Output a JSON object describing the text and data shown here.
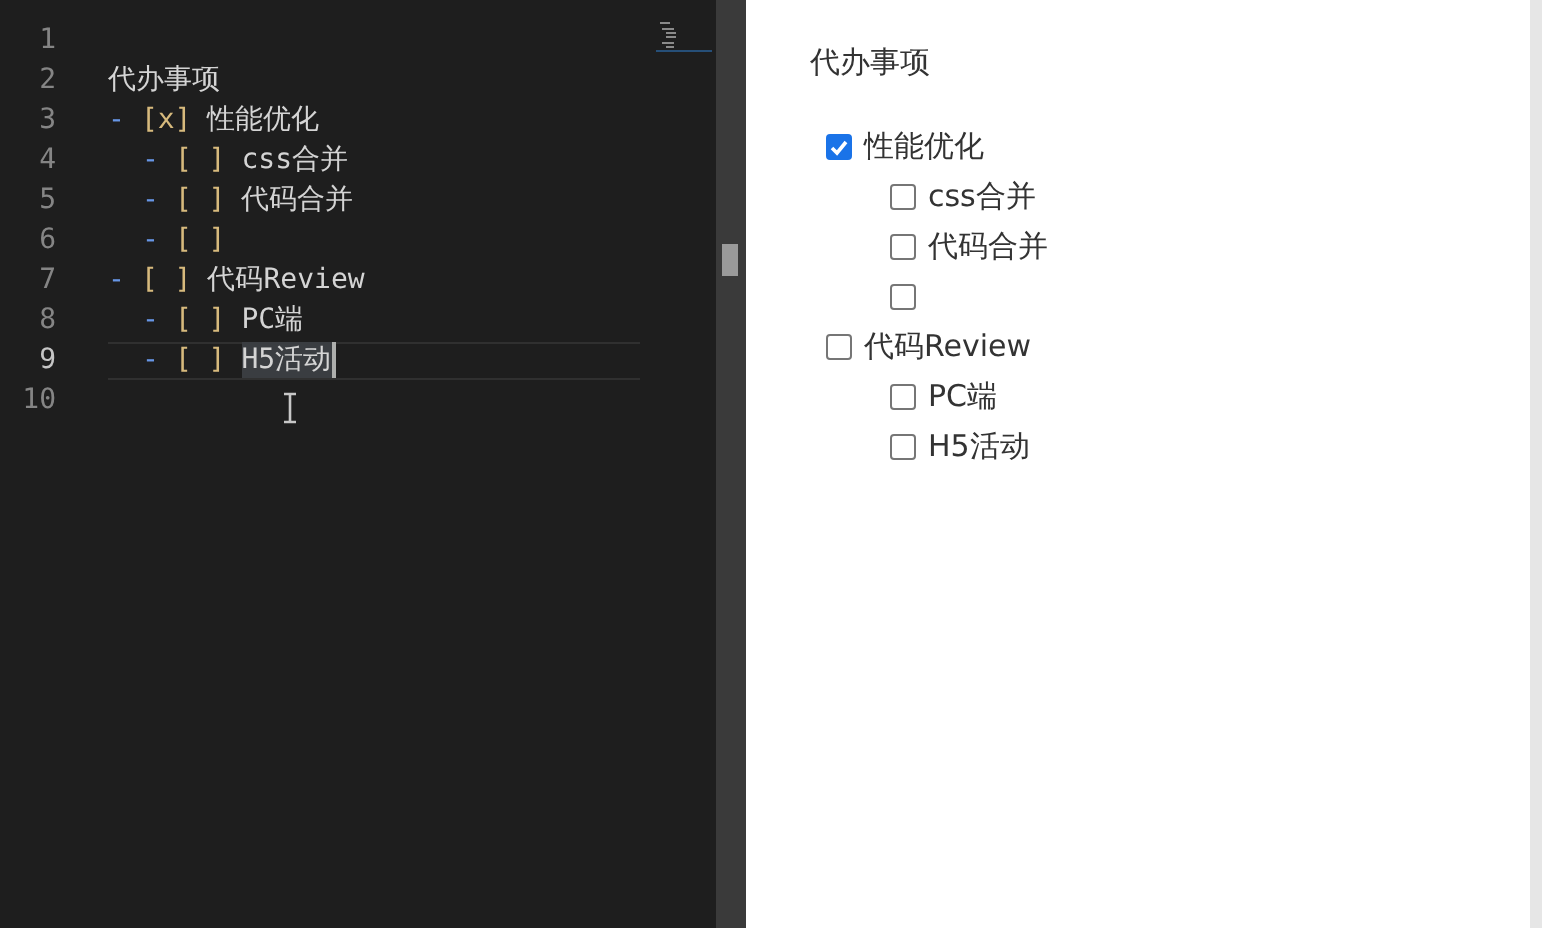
{
  "editor": {
    "lines": [
      {
        "number": "1",
        "current": false
      },
      {
        "number": "2",
        "current": false,
        "segments": [
          {
            "kind": "text",
            "text": "代办事项"
          }
        ]
      },
      {
        "number": "3",
        "current": false,
        "segments": [
          {
            "kind": "marker",
            "text": "-"
          },
          {
            "kind": "box",
            "text": "[x]"
          },
          {
            "kind": "text",
            "text": "性能优化"
          }
        ]
      },
      {
        "number": "4",
        "current": false,
        "segments": [
          {
            "kind": "indent"
          },
          {
            "kind": "marker",
            "text": "-"
          },
          {
            "kind": "box",
            "text": "[ ]"
          },
          {
            "kind": "text",
            "text": "css合并"
          }
        ]
      },
      {
        "number": "5",
        "current": false,
        "segments": [
          {
            "kind": "indent"
          },
          {
            "kind": "marker",
            "text": "-"
          },
          {
            "kind": "box",
            "text": "[ ]"
          },
          {
            "kind": "text",
            "text": "代码合并"
          }
        ]
      },
      {
        "number": "6",
        "current": false,
        "segments": [
          {
            "kind": "indent"
          },
          {
            "kind": "marker",
            "text": "-"
          },
          {
            "kind": "box",
            "text": "[ ]"
          }
        ]
      },
      {
        "number": "7",
        "current": false,
        "segments": [
          {
            "kind": "marker",
            "text": "-"
          },
          {
            "kind": "box",
            "text": "[ ]"
          },
          {
            "kind": "text",
            "text": "代码Review"
          }
        ]
      },
      {
        "number": "8",
        "current": false,
        "segments": [
          {
            "kind": "indent"
          },
          {
            "kind": "marker",
            "text": "-"
          },
          {
            "kind": "box",
            "text": "[ ]"
          },
          {
            "kind": "text",
            "text": "PC端"
          }
        ]
      },
      {
        "number": "9",
        "current": true,
        "segments": [
          {
            "kind": "indent"
          },
          {
            "kind": "marker",
            "text": "-"
          },
          {
            "kind": "box",
            "text": "[ ]"
          },
          {
            "kind": "selected",
            "text": "H5活动"
          }
        ]
      },
      {
        "number": "10",
        "current": false
      }
    ]
  },
  "preview": {
    "title": "代办事项",
    "items": [
      {
        "label": "性能优化",
        "checked": true,
        "children": [
          {
            "label": "css合并",
            "checked": false
          },
          {
            "label": "代码合并",
            "checked": false
          },
          {
            "checked": false
          }
        ]
      },
      {
        "label": "代码Review",
        "checked": false,
        "children": [
          {
            "label": "PC端",
            "checked": false
          },
          {
            "label": "H5活动",
            "checked": false
          }
        ]
      }
    ]
  }
}
